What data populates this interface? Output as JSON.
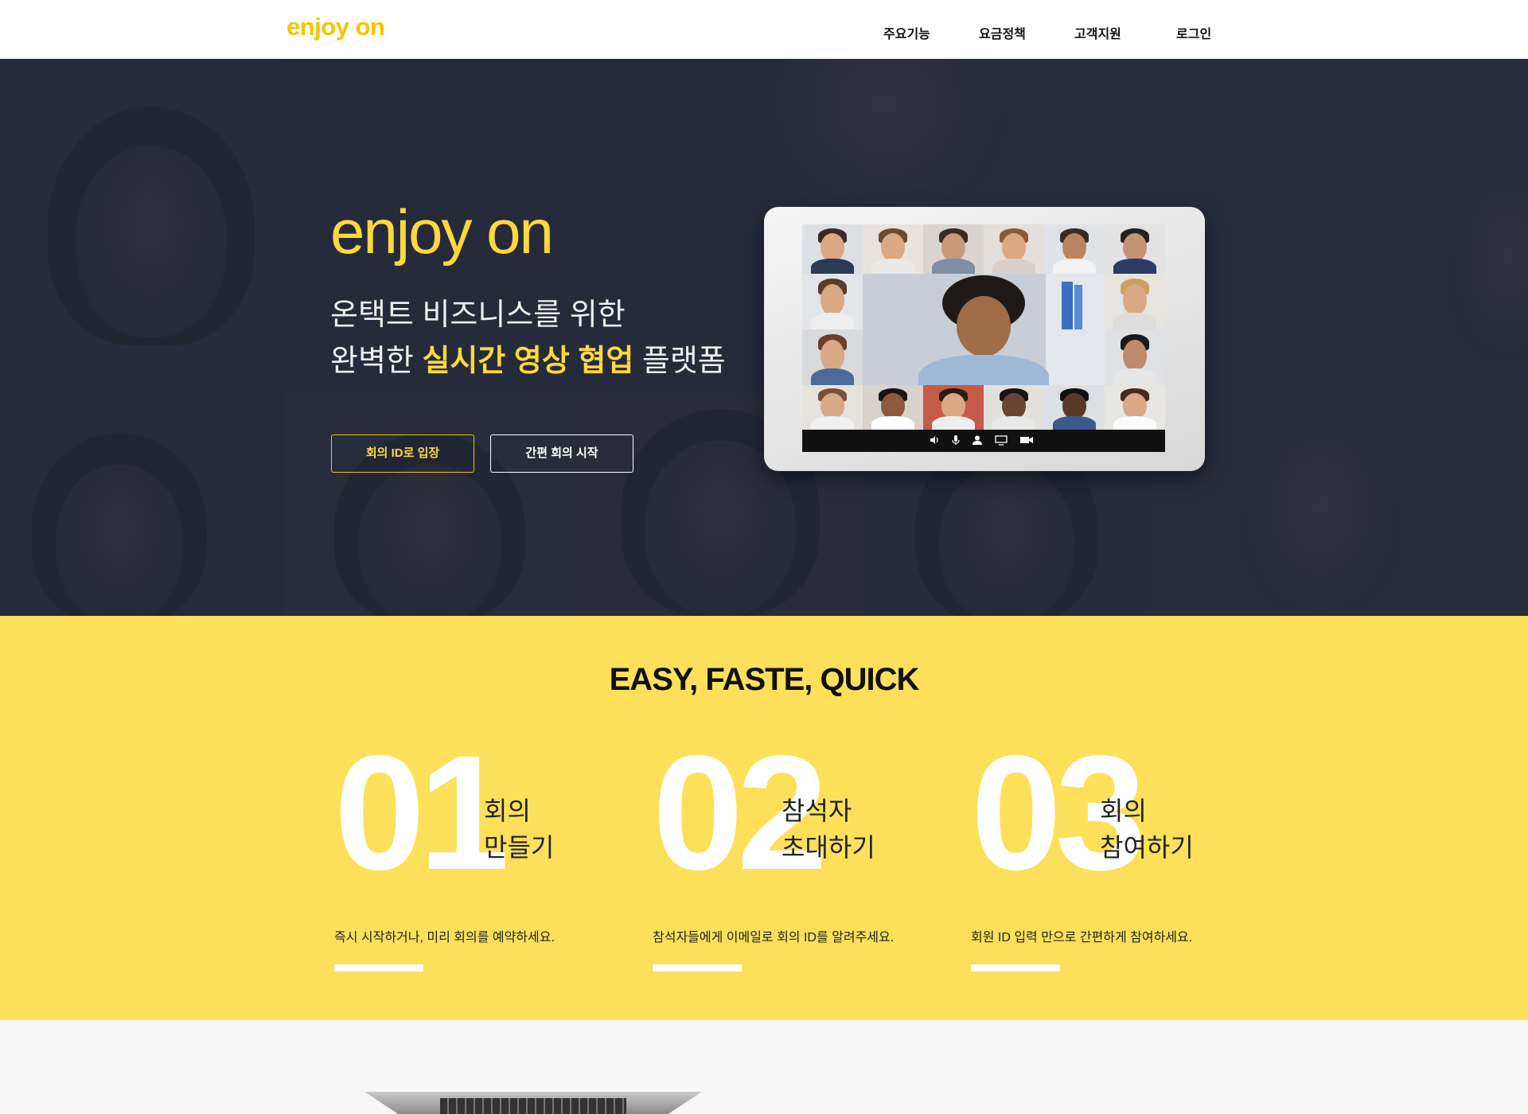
{
  "header": {
    "logo": "enjoy on",
    "nav": [
      "주요기능",
      "요금정책",
      "고객지원",
      "로그인"
    ]
  },
  "hero": {
    "brand": "enjoy on",
    "subtitle_line1": "온택트 비즈니스를 위한",
    "subtitle_line2_prefix": "완벽한",
    "subtitle_line2_highlight": "실시간 영상 협업",
    "subtitle_line2_suffix": "플랫폼",
    "btn_meeting_id": "회의 ID로 입장",
    "btn_quick_start": "간편 회의 시작"
  },
  "features": {
    "title": "EASY, FASTE, QUICK",
    "steps": [
      {
        "number": "01",
        "label_line1": "회의",
        "label_line2": "만들기",
        "description": "즉시 시작하거나, 미리 회의를 예약하세요."
      },
      {
        "number": "02",
        "label_line1": "참석자",
        "label_line2": "초대하기",
        "description": "참석자들에게 이메일로 회의 ID를 알려주세요."
      },
      {
        "number": "03",
        "label_line1": "회의",
        "label_line2": "참여하기",
        "description": "회원 ID 입력 만으로 간편하게 참여하세요."
      }
    ]
  },
  "colors": {
    "accent": "#f5c400",
    "highlight": "#ffd83d",
    "feature_bg": "#fde05a",
    "hero_overlay": "#1f2434"
  },
  "icons": {
    "video_controls": [
      "speaker-icon",
      "microphone-icon",
      "participants-icon",
      "screen-share-icon",
      "camera-icon"
    ]
  }
}
